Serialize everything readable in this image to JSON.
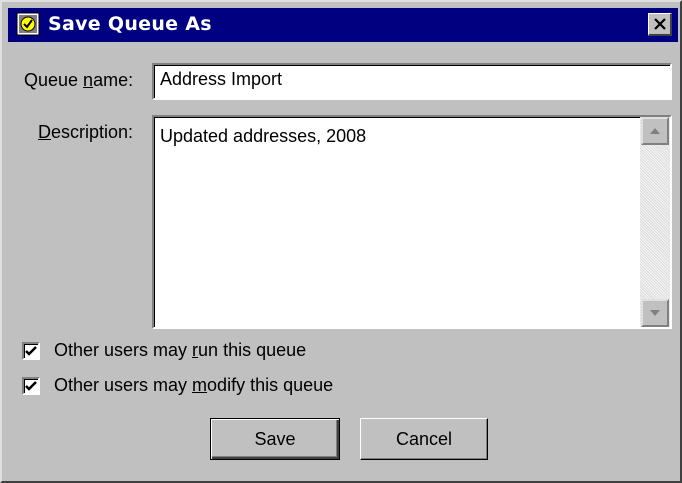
{
  "window": {
    "title": "Save Queue As",
    "icon": "queue-app-icon",
    "close_icon": "close-icon"
  },
  "queue_name": {
    "label_pre": "Queue ",
    "label_accel": "n",
    "label_post": "ame:",
    "value": "Address Import"
  },
  "description": {
    "label_pre": "",
    "label_accel": "D",
    "label_post": "escription:",
    "value": "Updated addresses, 2008"
  },
  "options": [
    {
      "label_pre": "Other users may ",
      "label_accel": "r",
      "label_post": "un this queue",
      "checked": true
    },
    {
      "label_pre": "Other users may ",
      "label_accel": "m",
      "label_post": "odify this queue",
      "checked": true
    }
  ],
  "buttons": {
    "save": "Save",
    "cancel": "Cancel"
  },
  "colors": {
    "titlebar": "#000080",
    "face": "#c0c0c0"
  }
}
